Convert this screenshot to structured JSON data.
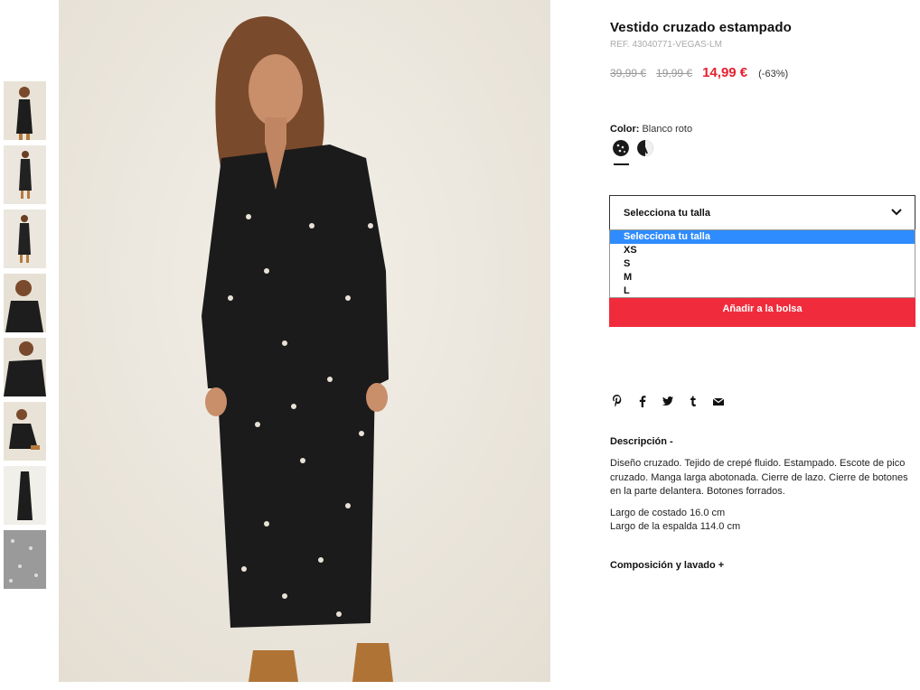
{
  "product": {
    "title": "Vestido cruzado estampado",
    "ref": "REF. 43040771-VEGAS-LM",
    "price_original": "39,99 €",
    "price_previous": "19,99 €",
    "price_current": "14,99 €",
    "discount": "(-63%)",
    "color_label": "Color:",
    "color_value": "Blanco roto"
  },
  "size": {
    "placeholder": "Selecciona tu talla",
    "options": [
      "Selecciona tu talla",
      "XS",
      "S",
      "M",
      "L"
    ],
    "selected_index": 0
  },
  "cart": {
    "add_label": "Añadir a la bolsa"
  },
  "social": [
    "pinterest-icon",
    "facebook-icon",
    "twitter-icon",
    "tumblr-icon",
    "email-icon"
  ],
  "description": {
    "title": "Descripción -",
    "text": "Diseño cruzado. Tejido de crepé fluido. Estampado. Escote de pico cruzado. Manga larga abotonada. Cierre de lazo. Cierre de botones en la parte delantera. Botones forrados.",
    "measure_1": "Largo de costado 16.0 cm",
    "measure_2": "Largo de la espalda 114.0 cm"
  },
  "composition": {
    "title": "Composición y lavado +"
  },
  "colors": {
    "accent": "#e8202e",
    "button": "#f02c3c",
    "dropdown_highlight": "#2f8cff"
  }
}
